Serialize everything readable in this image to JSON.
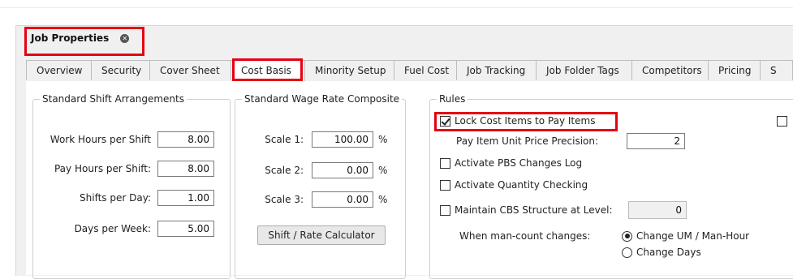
{
  "document_tab": {
    "title": "Job Properties",
    "close_icon": "close-icon"
  },
  "tabs": [
    {
      "label": "Overview"
    },
    {
      "label": "Security"
    },
    {
      "label": "Cover Sheet"
    },
    {
      "label": "Cost Basis",
      "active": true
    },
    {
      "label": "Minority Setup"
    },
    {
      "label": "Fuel Cost"
    },
    {
      "label": "Job Tracking"
    },
    {
      "label": "Job Folder Tags"
    },
    {
      "label": "Competitors"
    },
    {
      "label": "Pricing"
    },
    {
      "label": "S"
    }
  ],
  "shift": {
    "title": "Standard Shift Arrangements",
    "rows": [
      {
        "label": "Work Hours per Shift",
        "value": "8.00"
      },
      {
        "label": "Pay Hours per Shift:",
        "value": "8.00"
      },
      {
        "label": "Shifts per Day:",
        "value": "1.00"
      },
      {
        "label": "Days per Week:",
        "value": "5.00"
      }
    ]
  },
  "wage": {
    "title": "Standard Wage Rate Composite",
    "rows": [
      {
        "label": "Scale 1:",
        "value": "100.00",
        "unit": "%"
      },
      {
        "label": "Scale 2:",
        "value": "0.00",
        "unit": "%"
      },
      {
        "label": "Scale 3:",
        "value": "0.00",
        "unit": "%"
      }
    ],
    "button": "Shift / Rate Calculator"
  },
  "rules": {
    "title": "Rules",
    "lock_cost_items": {
      "label": "Lock Cost Items to Pay Items",
      "checked": true
    },
    "precision": {
      "label": "Pay Item Unit Price Precision:",
      "value": "2"
    },
    "pbs_log": {
      "label": "Activate PBS Changes Log",
      "checked": false
    },
    "quantity_checking": {
      "label": "Activate Quantity Checking",
      "checked": false
    },
    "cbs_structure": {
      "label": "Maintain CBS Structure at Level:",
      "checked": false,
      "value": "0"
    },
    "mancount": {
      "label": "When man-count changes:",
      "options": [
        {
          "label": "Change UM / Man-Hour",
          "selected": true
        },
        {
          "label": "Change Days",
          "selected": false
        }
      ]
    }
  },
  "highlight_color": "#e60012"
}
